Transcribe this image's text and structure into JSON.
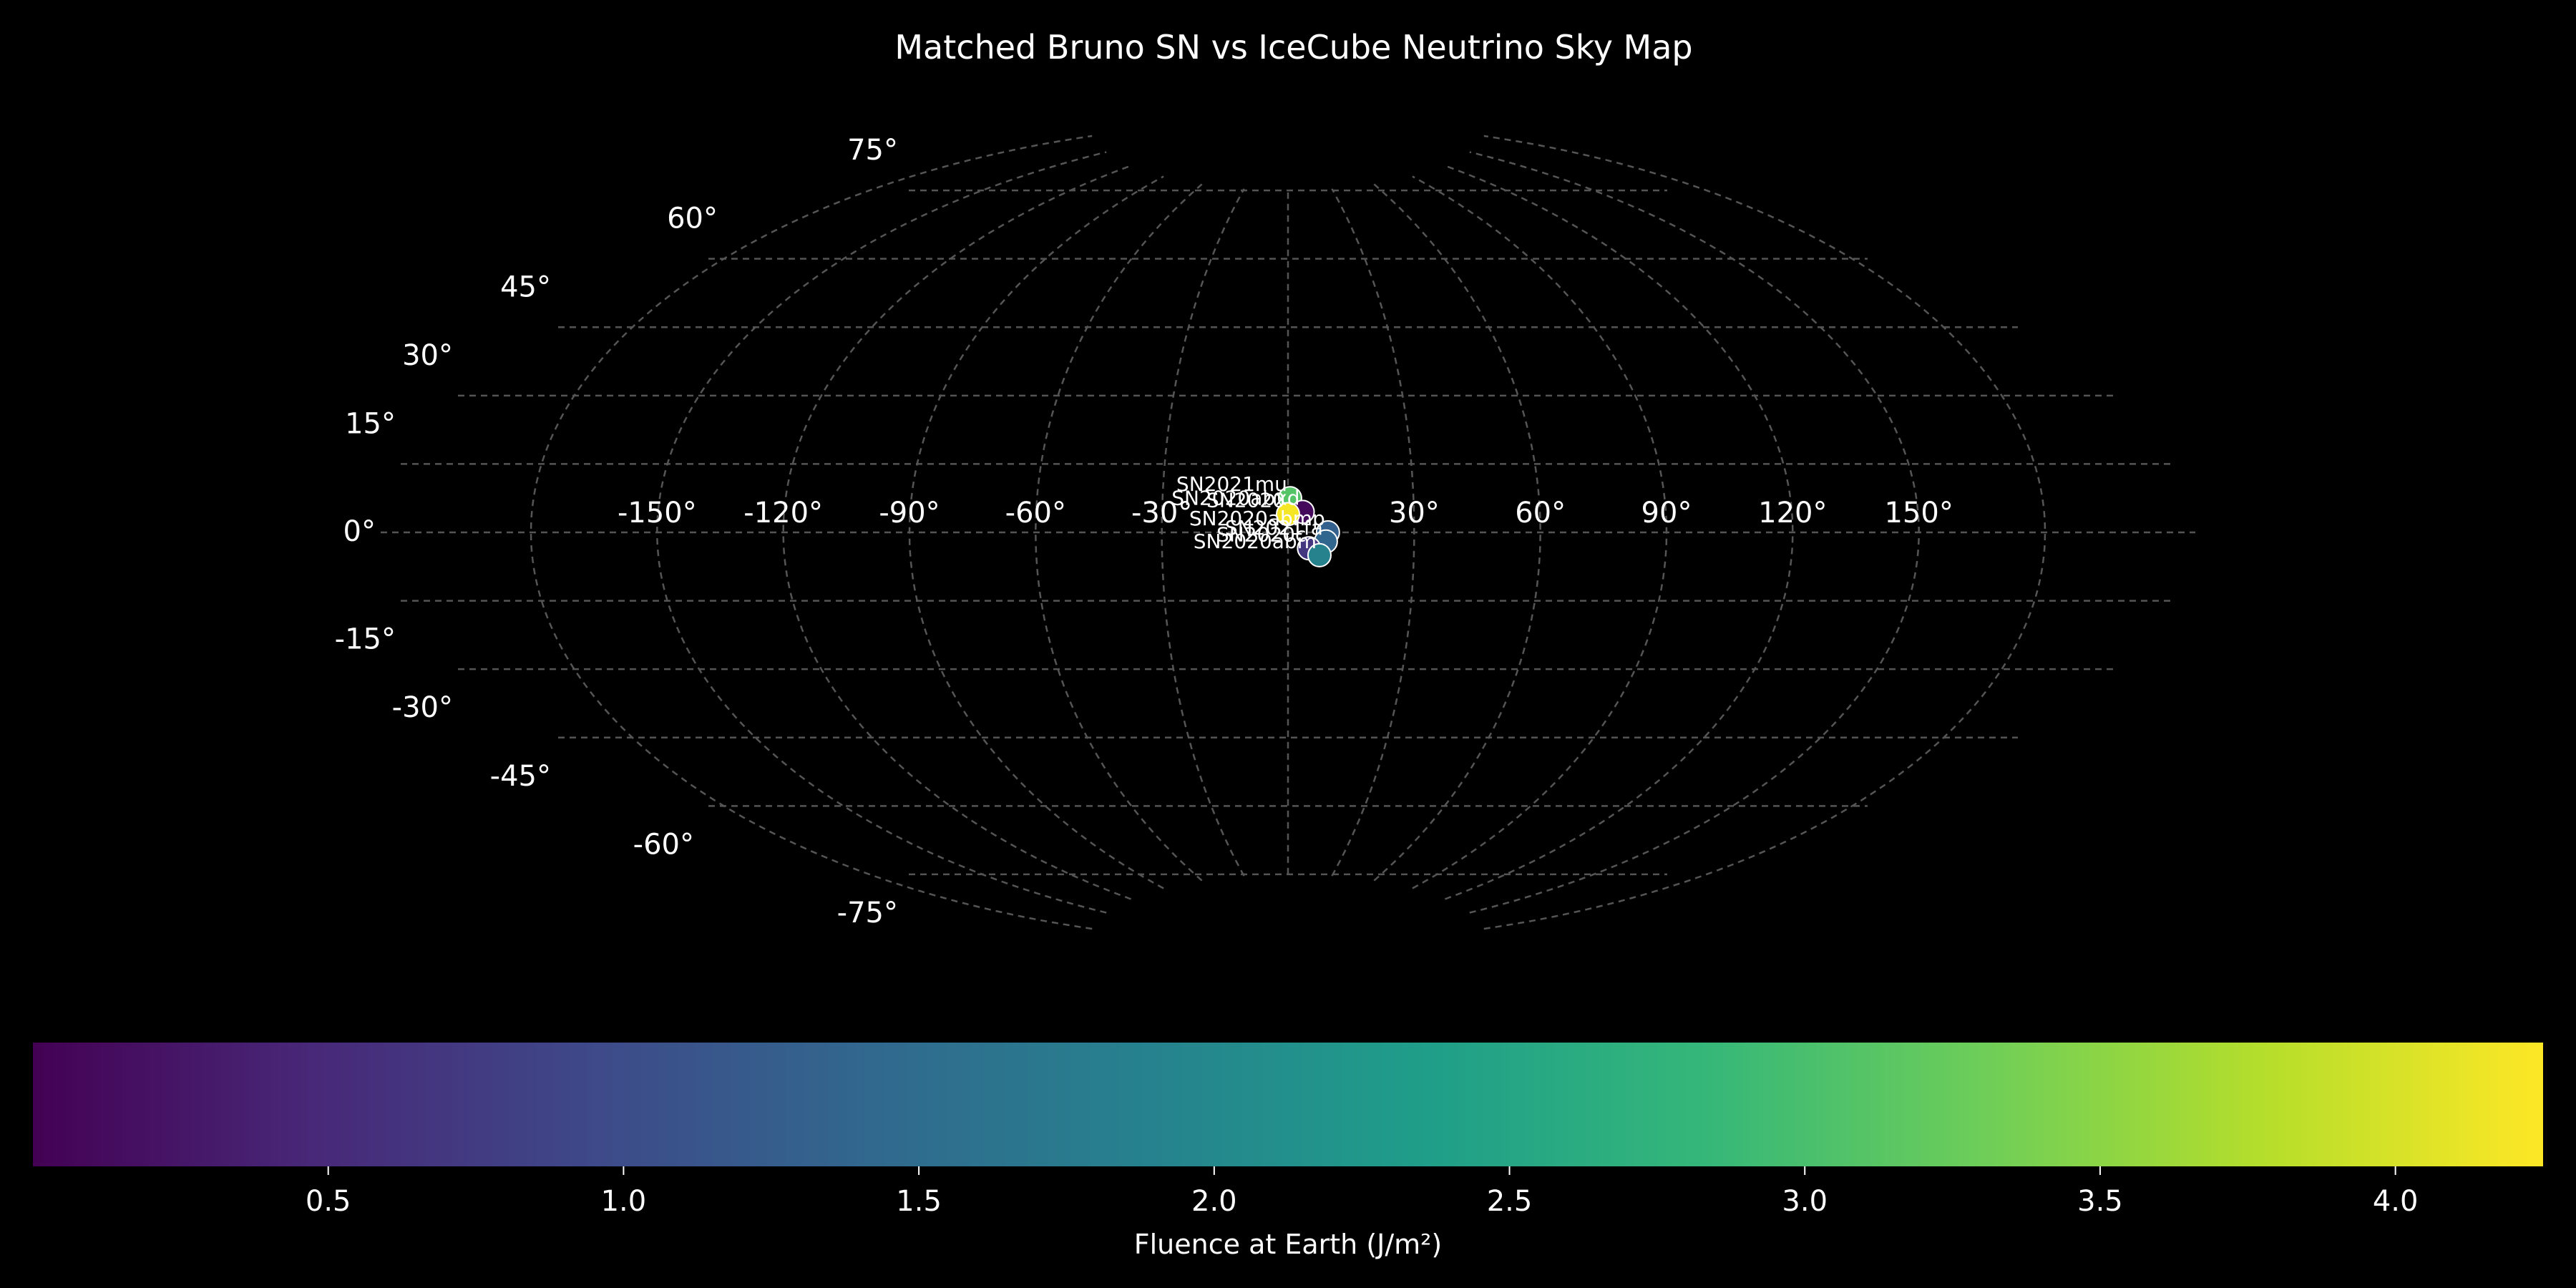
{
  "chart_data": {
    "type": "scatter",
    "projection": "aitoff",
    "title": "Matched Bruno SN vs IceCube Neutrino Sky Map",
    "background": "#000000",
    "grid": true,
    "grid_color": "#555555",
    "lon_ticks": [
      -150,
      -120,
      -90,
      -60,
      -30,
      0,
      30,
      60,
      90,
      120,
      150
    ],
    "lon_tick_labels": [
      "-150°",
      "-120°",
      "-90°",
      "-60°",
      "-30°",
      "",
      "30°",
      "60°",
      "90°",
      "120°",
      "150°"
    ],
    "lat_ticks": [
      75,
      60,
      45,
      30,
      15,
      0,
      -15,
      -30,
      -45,
      -60,
      -75
    ],
    "lat_tick_labels": [
      "75°",
      "60°",
      "45°",
      "30°",
      "15°",
      "0°",
      "-15°",
      "-30°",
      "-45°",
      "-60°",
      "-75°"
    ],
    "points": [
      {
        "label": "SN2021mu",
        "lon": 0.5,
        "lat": 7.5,
        "value": 3.1
      },
      {
        "label": "SN2020abxd",
        "lon": 3.5,
        "lat": 4.5,
        "value": 0.1
      },
      {
        "label": "SN2020",
        "lon": 0.0,
        "lat": 4.0,
        "value": 4.2
      },
      {
        "label": "SN2020abmp",
        "lon": 9.5,
        "lat": 0.0,
        "value": 1.3
      },
      {
        "label": "SN2021fa",
        "lon": 9.0,
        "lat": -2.0,
        "value": 1.4
      },
      {
        "label": "SN2020c",
        "lon": 5.0,
        "lat": -3.5,
        "value": 0.7
      },
      {
        "label": "SN2020abm",
        "lon": 7.5,
        "lat": -5.0,
        "value": 1.9
      }
    ],
    "colorbar": {
      "colormap": "viridis",
      "label": "Fluence at Earth (J/m²)",
      "vmin": 0.0,
      "vmax": 4.25,
      "ticks": [
        0.5,
        1.0,
        1.5,
        2.0,
        2.5,
        3.0,
        3.5,
        4.0
      ],
      "tick_labels": [
        "0.5",
        "1.0",
        "1.5",
        "2.0",
        "2.5",
        "3.0",
        "3.5",
        "4.0"
      ],
      "colors": [
        "#440154",
        "#482878",
        "#3e4989",
        "#31688e",
        "#26828e",
        "#1f9e89",
        "#35b779",
        "#6ece58",
        "#b5de2b",
        "#fde725"
      ]
    }
  }
}
